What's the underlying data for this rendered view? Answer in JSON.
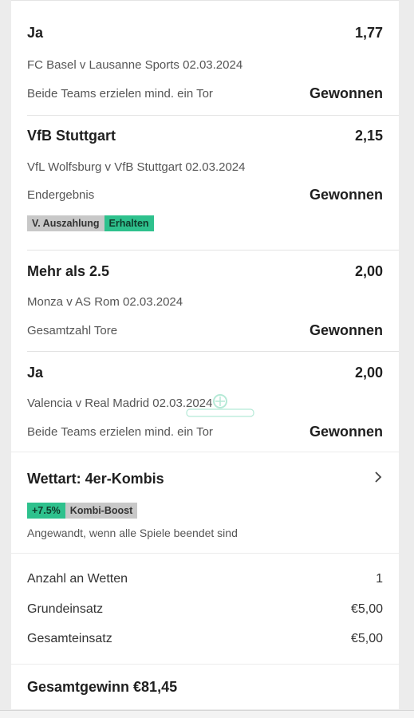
{
  "selections": [
    {
      "pick": "Ja",
      "odds": "1,77",
      "match": "FC Basel v Lausanne Sports 02.03.2024",
      "market": "Beide Teams erzielen mind. ein Tor",
      "result": "Gewonnen"
    },
    {
      "pick": "VfB Stuttgart",
      "odds": "2,15",
      "match": "VfL Wolfsburg v VfB Stuttgart 02.03.2024",
      "market": "Endergebnis",
      "result": "Gewonnen",
      "tags": [
        "V. Auszahlung",
        "Erhalten"
      ]
    },
    {
      "pick": "Mehr als 2.5",
      "odds": "2,00",
      "match": "Monza v AS Rom 02.03.2024",
      "market": "Gesamtzahl Tore",
      "result": "Gewonnen"
    },
    {
      "pick": "Ja",
      "odds": "2,00",
      "match": "Valencia v Real Madrid 02.03.2024",
      "market": "Beide Teams erzielen mind. ein Tor",
      "result": "Gewonnen"
    }
  ],
  "bet_type": {
    "title": "Wettart: 4er-Kombis",
    "boost_percent": "+7.5%",
    "boost_label": "Kombi-Boost",
    "note": "Angewandt, wenn alle Spiele beendet sind",
    "chevron_icon": "chevron-right-icon"
  },
  "stake": {
    "rows": [
      {
        "label": "Anzahl an Wetten",
        "value": "1"
      },
      {
        "label": "Grundeinsatz",
        "value": "€5,00"
      },
      {
        "label": "Gesamteinsatz",
        "value": "€5,00"
      }
    ]
  },
  "total": {
    "text": "Gesamtgewinn €81,45"
  },
  "colors": {
    "accent_green": "#2ec18d",
    "tag_grey": "#c8c8c8",
    "background": "#ececec"
  }
}
